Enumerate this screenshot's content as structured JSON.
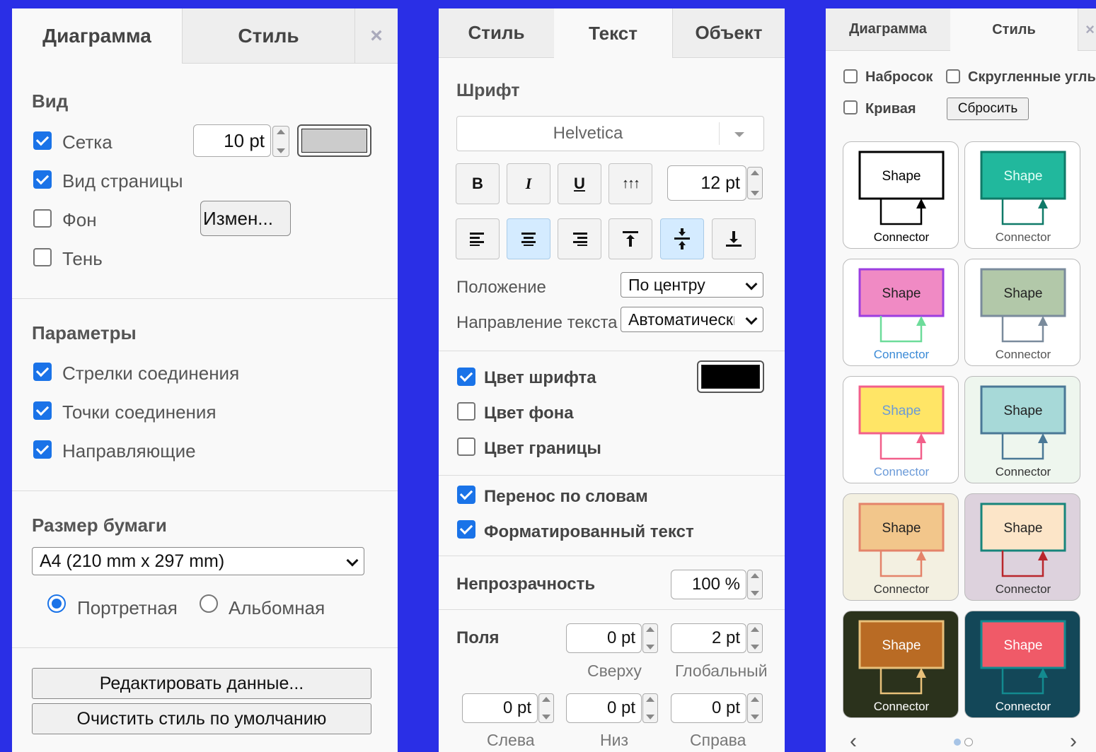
{
  "panel1": {
    "tabs": [
      "Диаграмма",
      "Стиль"
    ],
    "close_icon": "×",
    "view": {
      "heading": "Вид",
      "grid": {
        "label": "Сетка",
        "checked": true,
        "size": "10 pt",
        "color": "#cccccc"
      },
      "page_view": {
        "label": "Вид страницы",
        "checked": true
      },
      "background": {
        "label": "Фон",
        "checked": false,
        "button": "Измен..."
      },
      "shadow": {
        "label": "Тень",
        "checked": false
      }
    },
    "options": {
      "heading": "Параметры",
      "items": [
        {
          "label": "Стрелки соединения",
          "checked": true
        },
        {
          "label": "Точки соединения",
          "checked": true
        },
        {
          "label": "Направляющие",
          "checked": true
        }
      ]
    },
    "paper": {
      "heading": "Размер бумаги",
      "selected": "A4 (210 mm x 297 mm)",
      "portrait": "Портретная",
      "landscape": "Альбомная",
      "orientation": "portrait"
    },
    "buttons": [
      "Редактировать данные...",
      "Очистить стиль по умолчанию"
    ]
  },
  "panel2": {
    "tabs": [
      "Стиль",
      "Текст",
      "Объект"
    ],
    "font": {
      "heading": "Шрифт",
      "family": "Helvetica",
      "size": "12 pt",
      "bold_glyph": "B",
      "italic_glyph": "I",
      "underline_glyph": "U",
      "vertical_glyph": "↑↑↑",
      "position_label": "Положение",
      "position_value": "По центру",
      "direction_label": "Направление текста",
      "direction_value": "Автоматически"
    },
    "colors": {
      "font_color": {
        "label": "Цвет шрифта",
        "checked": true,
        "color": "#000000"
      },
      "bg_color": {
        "label": "Цвет фона",
        "checked": false
      },
      "border_color": {
        "label": "Цвет границы",
        "checked": false
      }
    },
    "wrap": {
      "label": "Перенос по словам",
      "checked": true
    },
    "formatted": {
      "label": "Форматированный текст",
      "checked": true
    },
    "opacity": {
      "label": "Непрозрачность",
      "value": "100 %"
    },
    "spacing": {
      "label": "Поля",
      "top": {
        "value": "0 pt",
        "label": "Сверху"
      },
      "global": {
        "value": "2 pt",
        "label": "Глобальный"
      },
      "left": {
        "value": "0 pt",
        "label": "Слева"
      },
      "bottom": {
        "value": "0 pt",
        "label": "Низ"
      },
      "right": {
        "value": "0 pt",
        "label": "Справа"
      }
    }
  },
  "panel3": {
    "tabs": [
      "Диаграмма",
      "Стиль"
    ],
    "close_icon": "×",
    "sketch": {
      "label": "Набросок",
      "checked": false
    },
    "rounded": {
      "label": "Скругленные углы",
      "checked": false
    },
    "curved": {
      "label": "Кривая",
      "checked": false
    },
    "reset": "Сбросить",
    "card_shape_text": "Shape",
    "card_connector_text": "Connector",
    "styles": [
      {
        "bg": "#ffffff",
        "fill": "#ffffff",
        "stroke": "#000000",
        "text": "#000000",
        "conn": "#000000",
        "ctext": "#000000"
      },
      {
        "bg": "#ffffff",
        "fill": "#21b89d",
        "stroke": "#0f7a68",
        "text": "#e4fff7",
        "conn": "#0f7a68",
        "ctext": "#555555"
      },
      {
        "bg": "#ffffff",
        "fill": "#f08ac4",
        "stroke": "#9b3ee0",
        "text": "#222222",
        "conn": "#6ddc9a",
        "ctext": "#3a8ad6"
      },
      {
        "bg": "#ffffff",
        "fill": "#b2c8a9",
        "stroke": "#7a8b9c",
        "text": "#222222",
        "conn": "#7a8b9c",
        "ctext": "#555555"
      },
      {
        "bg": "#ffffff",
        "fill": "#ffe566",
        "stroke": "#f25f8a",
        "text": "#6a9ad8",
        "conn": "#f25f8a",
        "ctext": "#6a9ad8"
      },
      {
        "bg": "#eef6ee",
        "fill": "#a7d9d8",
        "stroke": "#4a7896",
        "text": "#222222",
        "conn": "#4a7896",
        "ctext": "#333333"
      },
      {
        "bg": "#f3f0e1",
        "fill": "#f2c68b",
        "stroke": "#e4836a",
        "text": "#222222",
        "conn": "#e4836a",
        "ctext": "#333333"
      },
      {
        "bg": "#ddd2dd",
        "fill": "#fce5c8",
        "stroke": "#17857b",
        "text": "#222222",
        "conn": "#b9262c",
        "ctext": "#333333"
      },
      {
        "bg": "#2b321c",
        "fill": "#b96b24",
        "stroke": "#e8c07a",
        "text": "#ffffff",
        "conn": "#e8c07a",
        "ctext": "#ffffff"
      },
      {
        "bg": "#134758",
        "fill": "#f05a68",
        "stroke": "#138a8f",
        "text": "#ffffff",
        "conn": "#138a8f",
        "ctext": "#ffffff"
      }
    ],
    "pager": {
      "prev": "‹",
      "next": "›",
      "page": 1,
      "pages": 2
    }
  }
}
